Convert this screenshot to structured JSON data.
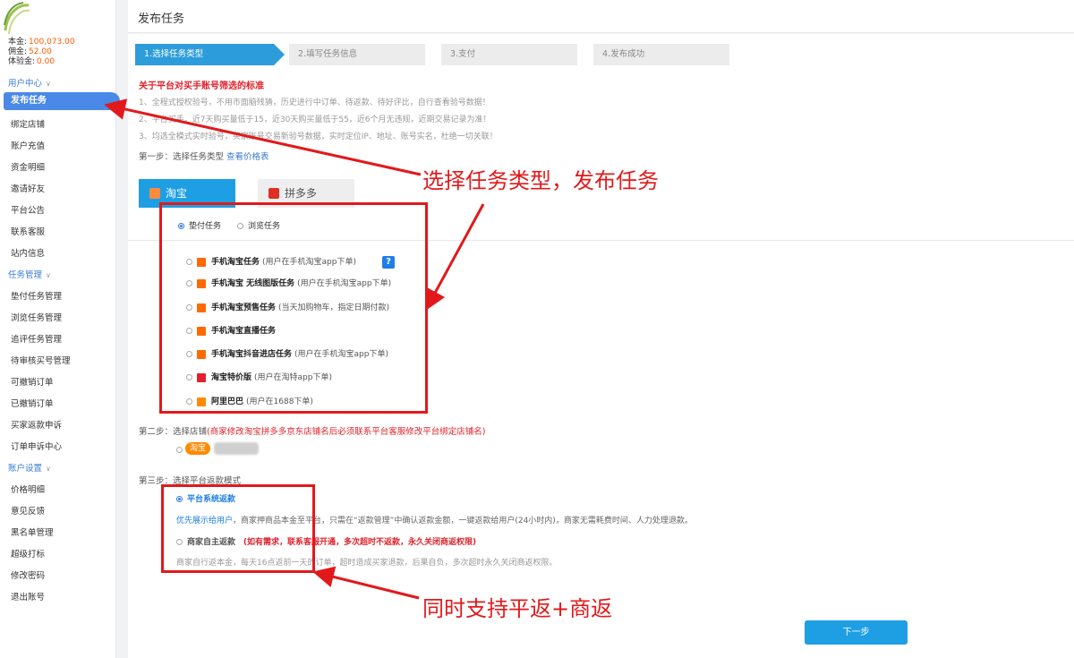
{
  "balances": [
    {
      "label": "本金:",
      "value": "100,073.00"
    },
    {
      "label": "佣金:",
      "value": "52.00"
    },
    {
      "label": "体验金:",
      "value": "0.00"
    }
  ],
  "sidebar": {
    "user_center": "用户中心",
    "task_manage": "任务管理",
    "account_settings": "账户设置",
    "active_item": "发布任务",
    "group1": [
      "绑定店铺",
      "账户充值",
      "资金明细",
      "邀请好友",
      "平台公告",
      "联系客服",
      "站内信息"
    ],
    "group2": [
      "垫付任务管理",
      "浏览任务管理",
      "追评任务管理",
      "待审核买号管理",
      "可撤销订单",
      "已撤销订单",
      "买家返款申诉",
      "订单申诉中心"
    ],
    "group3": [
      "价格明细",
      "意见反馈",
      "黑名单管理",
      "超级打标",
      "修改密码",
      "退出账号"
    ]
  },
  "header": {
    "title": "发布任务"
  },
  "steps": [
    "1.选择任务类型",
    "2.填写任务信息",
    "3.支付",
    "4.发布成功"
  ],
  "rules": {
    "title": "关于平台对买手账号筛选的标准",
    "items": [
      "1、全程式授权验号，不用市面脑残猜，历史进行中订单、待返款、待好评比，自行查看验号数据！",
      "2、平台买手，近7天购买量低于15，近30天购买量低于55，近6个月无违规，近期交易记录为准！",
      "3、均选全模式实时验号，买家账号交易新验号数据，实时定位IP、地址、账号实名，杜绝一切关联！"
    ]
  },
  "step1": {
    "label": "第一步：选择任务类型",
    "link": "查看价格表"
  },
  "platforms": [
    "淘宝",
    "拼多多"
  ],
  "task_modes": [
    "垫付任务",
    "浏览任务"
  ],
  "tasks": [
    {
      "name": "手机淘宝任务",
      "hint": "(用户在手机淘宝app下单)"
    },
    {
      "name": "手机淘宝 无线图版任务",
      "hint": "(用户在手机淘宝app下单)"
    },
    {
      "name": "手机淘宝预售任务",
      "hint": "(当天加购物车，指定日期付款)"
    },
    {
      "name": "手机淘宝直播任务",
      "hint": ""
    },
    {
      "name": "手机淘宝抖音进店任务",
      "hint": "(用户在手机淘宝app下单)"
    },
    {
      "name": "淘宝特价版",
      "hint": "(用户在淘特app下单)"
    },
    {
      "name": "阿里巴巴",
      "hint": "(用户在1688下单)"
    }
  ],
  "help_mark": "?",
  "step2": {
    "label": "第二步：选择店铺",
    "note": "(商家修改淘宝拼多多京东店铺名后必须联系平台客服修改平台绑定店铺名)",
    "shop_tag": "淘宝"
  },
  "step3": {
    "label": "第三步：选择平台返款模式",
    "platform_option": "平台系统返款",
    "platform_desc_hl": "优先展示给用户",
    "platform_desc": "，商家押商品本金至平台，只需在“返款管理”中确认返款金额，一键返款给用户(24小时内)，商家无需耗费时间、人力处理退款。",
    "merchant_option": "商家自主返款",
    "merchant_note": "(如有需求，联系客服开通，多次超时不返款，永久关闭商返权限)",
    "merchant_desc": "商家自行返本金，每天16点返前一天的订单，超时造成买家退款，后果自负，多次超时永久关闭商返权限。"
  },
  "next_button": "下一步",
  "annotations": {
    "a1": "选择任务类型，发布任务",
    "a2": "同时支持平返+商返"
  },
  "colors": {
    "accent": "#1e9fe4",
    "annotation": "#e2191b",
    "price": "#ff5a00"
  }
}
